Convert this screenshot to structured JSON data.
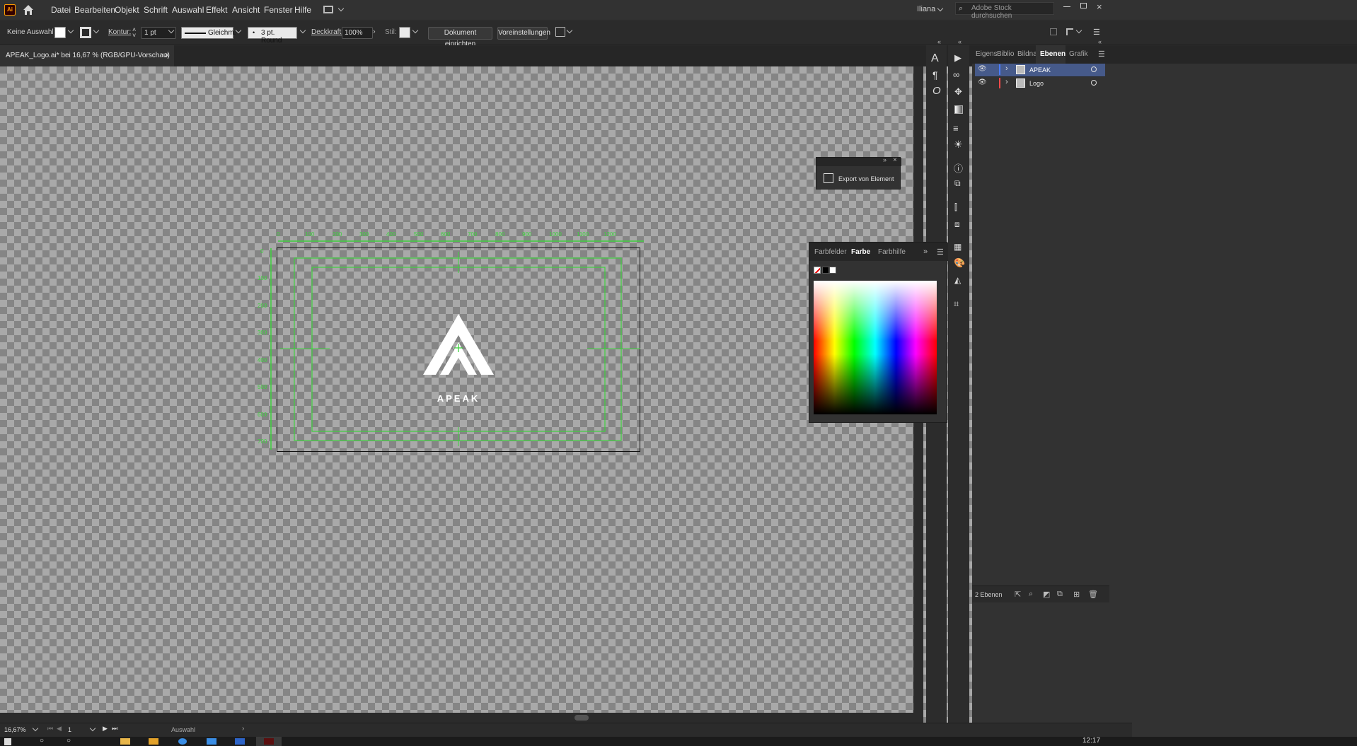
{
  "app": {
    "logo_text": "Ai",
    "menu": [
      "Datei",
      "Bearbeiten",
      "Objekt",
      "Schrift",
      "Auswahl",
      "Effekt",
      "Ansicht",
      "Fenster",
      "Hilfe"
    ],
    "user": "Iliana",
    "search_placeholder": "Adobe Stock durchsuchen"
  },
  "control_bar": {
    "selection": "Keine Auswahl",
    "kontur_label": "Kontur:",
    "kontur_value": "1 pt",
    "stroke_profile": "Gleichm.",
    "brush": "3 pt. Round",
    "opacity_label": "Deckkraft:",
    "opacity_value": "100%",
    "style_label": "Stil:",
    "doc_setup_button": "Dokument einrichten",
    "prefs_button": "Voreinstellungen"
  },
  "document_tab": {
    "title": "APEAK_Logo.ai* bei 16,67 % (RGB/GPU-Vorschau)",
    "close": "×"
  },
  "artwork": {
    "brand_text": "APEAK",
    "ruler_top": [
      "0",
      "100",
      "200",
      "300",
      "400",
      "500",
      "600",
      "700",
      "800",
      "900",
      "1000",
      "1100",
      "1200"
    ],
    "ruler_left": [
      "0",
      "100",
      "200",
      "300",
      "400",
      "500",
      "600",
      "700"
    ]
  },
  "export_panel": {
    "label": "Export von Element"
  },
  "color_panel": {
    "tabs": [
      "Farbfelder",
      "Farbe",
      "Farbhilfe"
    ],
    "active_tab": "Farbe"
  },
  "right_panel": {
    "tabs": [
      "Eigens",
      "Biblio",
      "Bildna",
      "Ebenen",
      "Grafik"
    ],
    "active_tab": "Ebenen",
    "layers": [
      {
        "name": "APEAK",
        "color": "#4a7cff",
        "selected": true
      },
      {
        "name": "Logo",
        "color": "#ff4a4a",
        "selected": false
      }
    ],
    "layer_count": "2 Ebenen"
  },
  "status_bar": {
    "zoom": "16,67%",
    "artboard": "1",
    "tool": "Auswahl"
  },
  "taskbar": {
    "time": "12:17"
  }
}
